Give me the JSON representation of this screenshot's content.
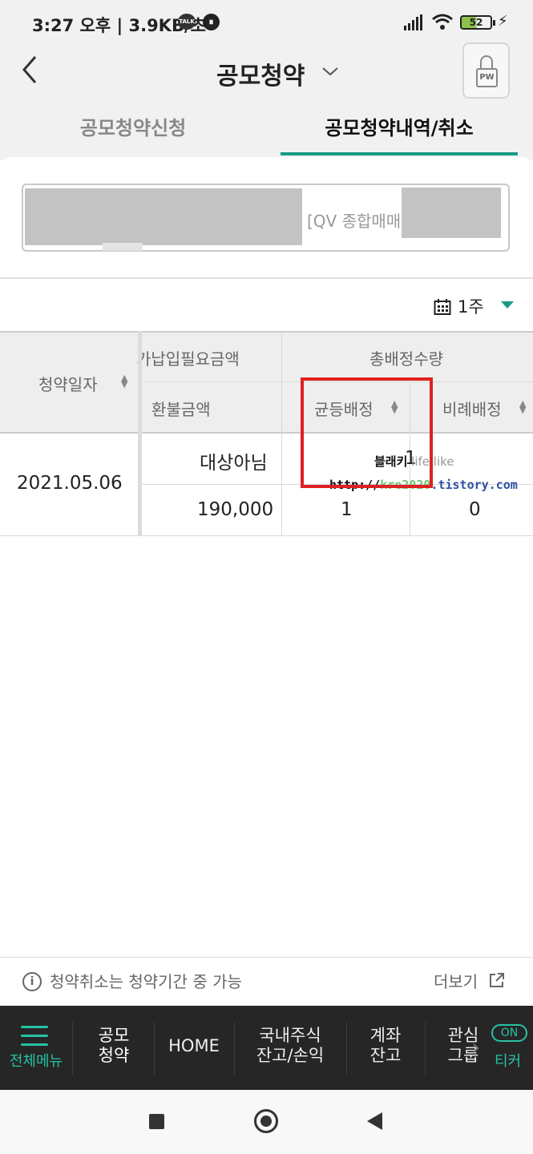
{
  "status_bar": {
    "time": "3:27 오후 | 3.9KB/초",
    "talk_badge": "TALK",
    "battery": "52"
  },
  "header": {
    "title": "공모청약",
    "pw_button_label": "PW"
  },
  "tabs": [
    {
      "label": "공모청약신청",
      "active": false
    },
    {
      "label": "공모청약내역/취소",
      "active": true
    }
  ],
  "account": {
    "label": "[QV 종합매매"
  },
  "period": {
    "label": "1주"
  },
  "table": {
    "headers": {
      "date": "청약일자",
      "required_amount": "가납입필요금액",
      "refund_amount": "환불금액",
      "total_allocation": "총배정수량",
      "equal_allocation": "균등배정",
      "proportional_allocation": "비례배정"
    },
    "rows": [
      {
        "date": "2021.05.06",
        "required_amount": "대상아님",
        "refund_amount": "190,000",
        "total_allocation": "1",
        "equal_allocation": "1",
        "proportional_allocation": "0"
      }
    ]
  },
  "watermark": {
    "line1_bold": "블래키",
    "line1_rest": " life like",
    "line2_a": "http://",
    "line2_b": "kre2020",
    "line2_c": ".tistory.com"
  },
  "notice": {
    "text": "청약취소는 청약기간 중 가능",
    "more": "더보기"
  },
  "bottom_nav": {
    "menu": "전체메뉴",
    "items": [
      {
        "line1": "공모",
        "line2": "청약"
      },
      {
        "line1": "HOME",
        "line2": ""
      },
      {
        "line1": "국내주식",
        "line2": "잔고/손익"
      },
      {
        "line1": "계좌",
        "line2": "잔고"
      },
      {
        "line1": "관심",
        "line2": "그룹"
      }
    ],
    "ticker_toggle": "ON",
    "ticker_label": "티커"
  },
  "colors": {
    "accent": "#1a9a86",
    "highlight": "#e02020",
    "nav_bg": "#262626"
  }
}
